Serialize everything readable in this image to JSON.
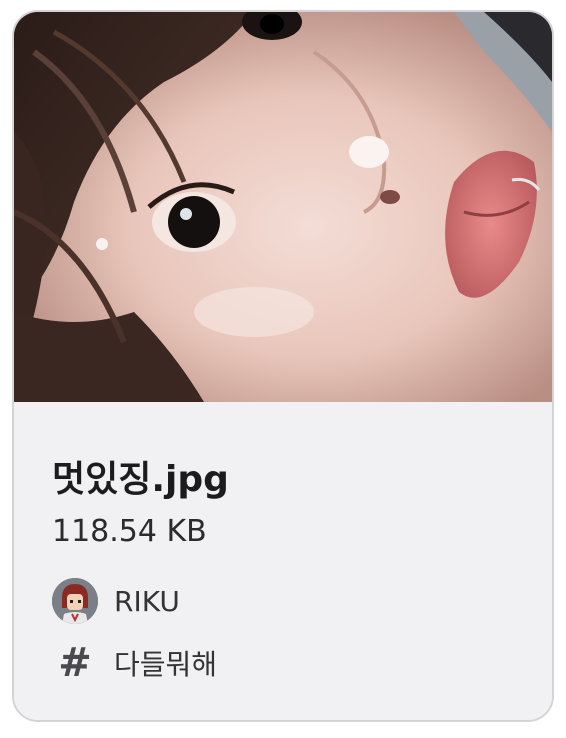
{
  "attachment": {
    "preview_alt": "멋있징.jpg",
    "file_name": "멋있징.jpg",
    "file_size": "118.54 KB"
  },
  "author": {
    "name": "RIKU",
    "avatar_icon": "user-avatar-icon"
  },
  "channel": {
    "icon": "hash-icon",
    "symbol": "#",
    "name": "다들뭐해"
  },
  "colors": {
    "card_bg": "#f1f1f4",
    "card_border": "#d4d4d8",
    "title_text": "#1c1c1e",
    "secondary_text": "#333336"
  }
}
